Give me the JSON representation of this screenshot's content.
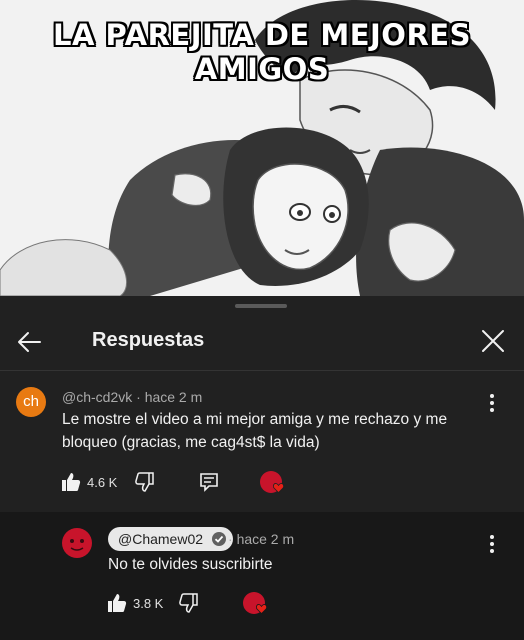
{
  "meme": {
    "title": "LA PAREJITA DE MEJORES AMIGOS"
  },
  "sheet": {
    "title": "Respuestas"
  },
  "comments": [
    {
      "avatar_text": "ch",
      "author": "@ch-cd2vk",
      "time": "hace 2 m",
      "text": "Le mostre el video a mi mejor amiga y me rechazo y me bloqueo (gracias, me cag4st$ la vida)",
      "likes": "4.6 K"
    },
    {
      "author": "@Chamew02",
      "time": "hace 2 m",
      "text": "No te olvides suscribirte",
      "likes": "3.8 K"
    }
  ],
  "colors": {
    "background": "#0f0f0f",
    "sheet": "#212121",
    "reply_bg": "#181818",
    "avatar_orange": "#e87a12",
    "avatar_red": "#c8142b"
  }
}
